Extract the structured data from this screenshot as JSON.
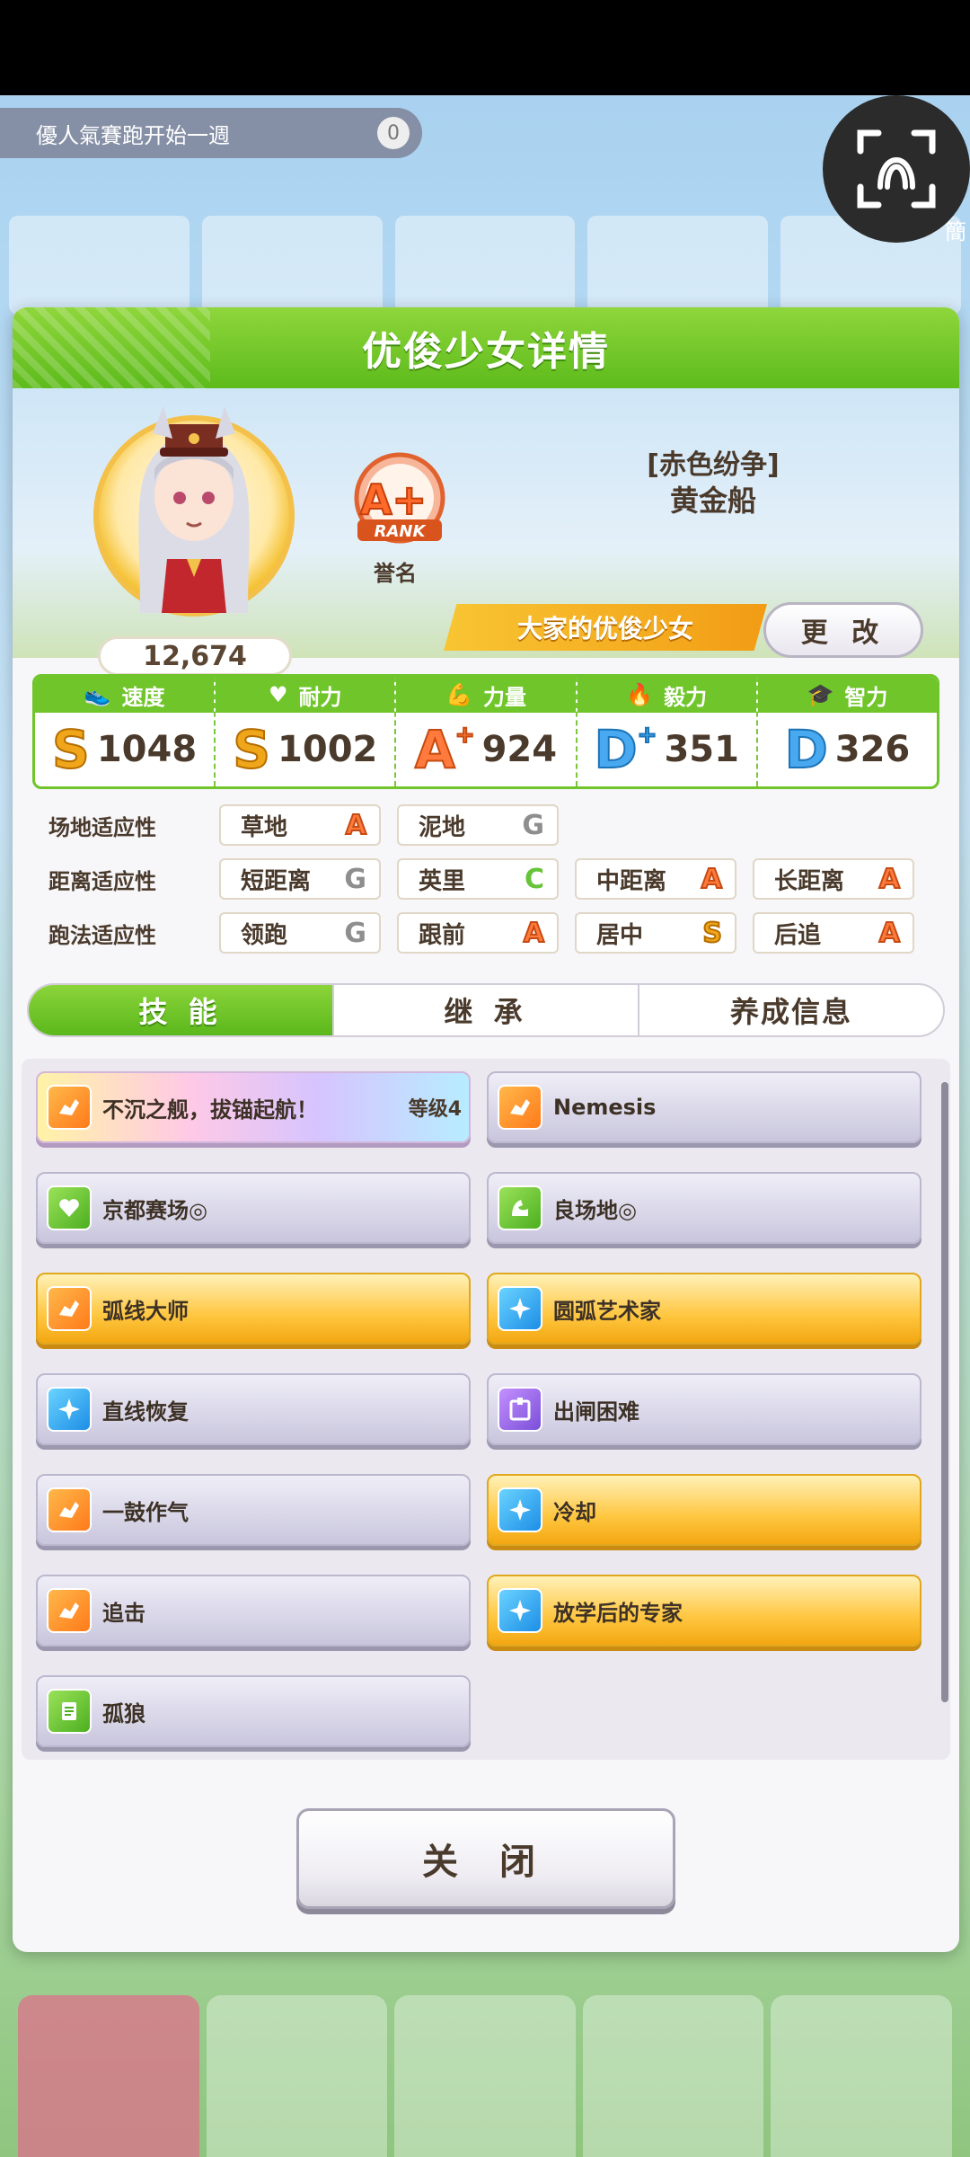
{
  "screen": {
    "scan_label": "簡",
    "bg_pill_text": "優人氣賽跑开始一週",
    "bg_pill_count": "0"
  },
  "dialog": {
    "title": "优俊少女详情",
    "character": {
      "score": "12,674",
      "rank": "A+",
      "rank_word": "RANK",
      "rank_caption": "誉名",
      "epithet": "[赤色纷争]",
      "name": "黄金船",
      "title_ribbon": "大家的优俊少女",
      "change_button": "更 改"
    },
    "stats": [
      {
        "label": "速度",
        "icon": "shoe-icon",
        "grade": "S",
        "plus": "",
        "value": "1048"
      },
      {
        "label": "耐力",
        "icon": "heart-icon",
        "grade": "S",
        "plus": "",
        "value": "1002"
      },
      {
        "label": "力量",
        "icon": "muscle-icon",
        "grade": "A",
        "plus": "+",
        "value": "924"
      },
      {
        "label": "毅力",
        "icon": "flame-icon",
        "grade": "D",
        "plus": "+",
        "value": "351"
      },
      {
        "label": "智力",
        "icon": "graduation-cap-icon",
        "grade": "D",
        "plus": "",
        "value": "326"
      }
    ],
    "aptitude": {
      "track": {
        "label": "场地适应性",
        "items": [
          {
            "name": "草地",
            "grade": "A"
          },
          {
            "name": "泥地",
            "grade": "G"
          }
        ]
      },
      "distance": {
        "label": "距离适应性",
        "items": [
          {
            "name": "短距离",
            "grade": "G"
          },
          {
            "name": "英里",
            "grade": "C"
          },
          {
            "name": "中距离",
            "grade": "A"
          },
          {
            "name": "长距离",
            "grade": "A"
          }
        ]
      },
      "style": {
        "label": "跑法适应性",
        "items": [
          {
            "name": "领跑",
            "grade": "G"
          },
          {
            "name": "跟前",
            "grade": "A"
          },
          {
            "name": "居中",
            "grade": "S"
          },
          {
            "name": "后追",
            "grade": "A"
          }
        ]
      }
    },
    "tabs": [
      "技 能",
      "继 承",
      "养成信息"
    ],
    "skills": [
      {
        "name": "不沉之舰，拔锚起航！",
        "level": "等级4",
        "style": "rainbow",
        "icon": "running-horse-icon"
      },
      {
        "name": "Nemesis",
        "level": "",
        "style": "silver",
        "icon": "running-horse-icon"
      },
      {
        "name": "京都赛场◎",
        "level": "",
        "style": "silver",
        "icon": "heart-icon"
      },
      {
        "name": "良场地◎",
        "level": "",
        "style": "silver",
        "icon": "muscle-icon"
      },
      {
        "name": "弧线大师",
        "level": "",
        "style": "gold",
        "icon": "running-horse-icon"
      },
      {
        "name": "圆弧艺术家",
        "level": "",
        "style": "gold",
        "icon": "sparkle-icon"
      },
      {
        "name": "直线恢复",
        "level": "",
        "style": "silver",
        "icon": "sparkle-icon"
      },
      {
        "name": "出闸困难",
        "level": "",
        "style": "silver",
        "icon": "gate-icon"
      },
      {
        "name": "一鼓作气",
        "level": "",
        "style": "silver",
        "icon": "running-horse-icon"
      },
      {
        "name": "冷却",
        "level": "",
        "style": "gold",
        "icon": "sparkle-icon"
      },
      {
        "name": "追击",
        "level": "",
        "style": "silver",
        "icon": "running-horse-icon"
      },
      {
        "name": "放学后的专家",
        "level": "",
        "style": "gold",
        "icon": "sparkle-icon"
      },
      {
        "name": "孤狼",
        "level": "",
        "style": "silver",
        "icon": "document-icon"
      }
    ],
    "close_button": "关 闭"
  },
  "colors": {
    "header_green": "#5dbb1b",
    "gold": "#f3a712",
    "accent_orange": "#ff7a3c",
    "accent_blue": "#49a9f0"
  }
}
